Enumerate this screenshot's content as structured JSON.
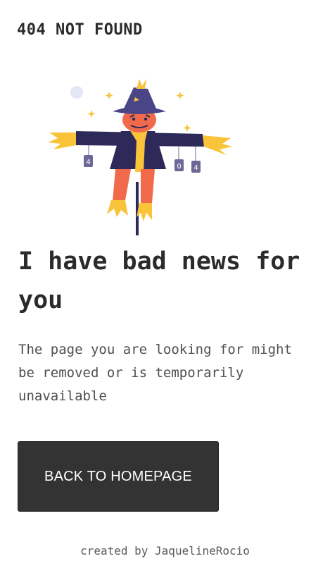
{
  "header": {
    "brand": "404 NOT FOUND"
  },
  "illustration": {
    "icon": "scarecrow-illustration",
    "tag_left": "4",
    "tag_mid": "0",
    "tag_right": "4"
  },
  "main": {
    "headline": "I have bad news for you",
    "message": "The page you are looking for might be removed or is temporarily unavailable",
    "button_label": "BACK TO HOMEPAGE"
  },
  "footer": {
    "credit": "created by JaquelineRocio"
  },
  "colors": {
    "button_bg": "#333333",
    "button_text": "#ffffff",
    "text": "#333333",
    "scarecrow_body": "#2d2a5a",
    "scarecrow_head": "#f16a4c",
    "straw": "#f9c43a"
  }
}
